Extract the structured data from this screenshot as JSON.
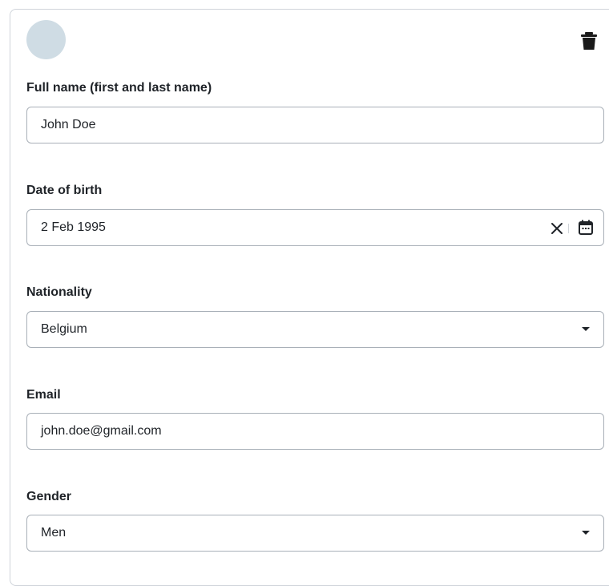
{
  "form": {
    "delete_icon": "trash-icon",
    "avatar_color": "#cfdce4",
    "full_name": {
      "label": "Full name (first and last name)",
      "value": "John Doe"
    },
    "date_of_birth": {
      "label": "Date of birth",
      "value": "2 Feb 1995",
      "clear_icon": "close-icon",
      "calendar_icon": "calendar-icon"
    },
    "nationality": {
      "label": "Nationality",
      "value": "Belgium"
    },
    "email": {
      "label": "Email",
      "value": "john.doe@gmail.com"
    },
    "gender": {
      "label": "Gender",
      "value": "Men"
    }
  }
}
